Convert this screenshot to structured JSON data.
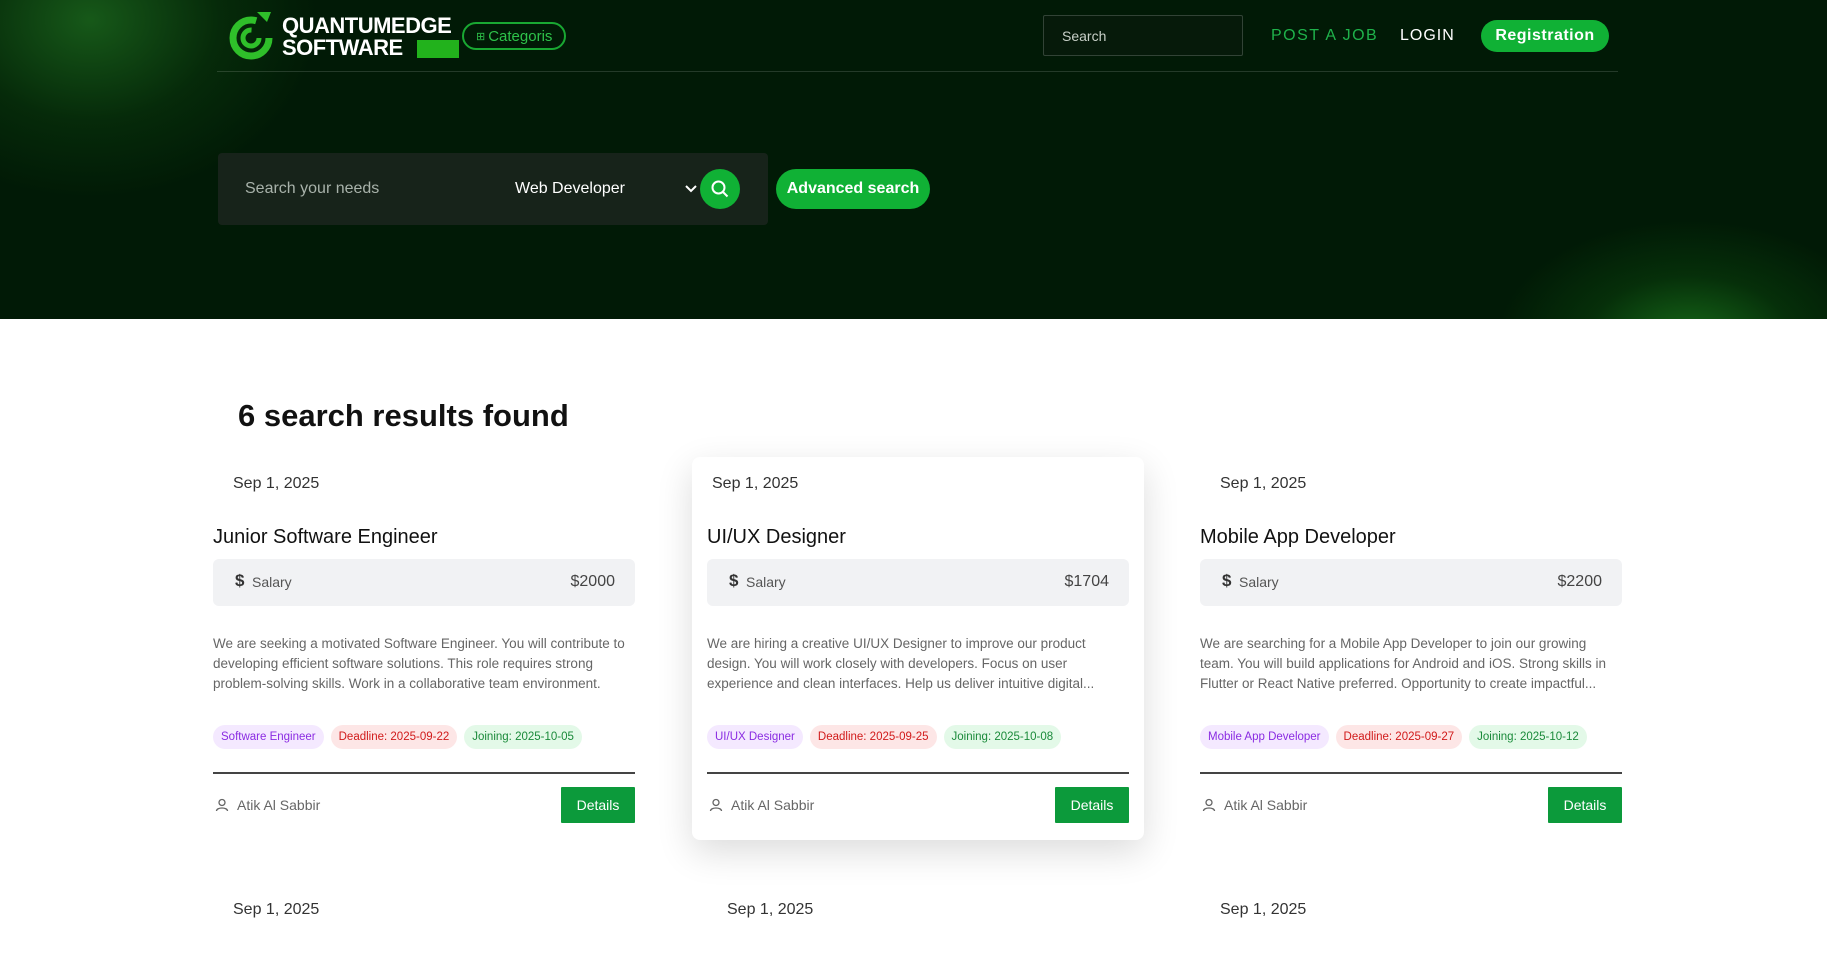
{
  "nav": {
    "logo_line1": "QUANTUMEDGE",
    "logo_line2": "SOFTWARE",
    "categories_label": "Categoris",
    "search_placeholder": "Search",
    "post_job": "POST A JOB",
    "login": "LOGIN",
    "registration": "Registration"
  },
  "hero": {
    "needs_placeholder": "Search your needs",
    "selected_role": "Web Developer",
    "advanced_search": "Advanced search"
  },
  "results": {
    "heading": "6 search results found",
    "jobs": [
      {
        "date": "Sep 1, 2025",
        "title": "Junior Software Engineer",
        "salary_label": "Salary",
        "salary": "$2000",
        "description": "We are seeking a motivated Software Engineer. You will contribute to developing efficient software solutions. This role requires strong problem-solving skills. Work in a collaborative team environment.",
        "role_tag": "Software Engineer",
        "deadline": "Deadline: 2025-09-22",
        "joining": "Joining: 2025-10-05",
        "author": "Atik Al Sabbir",
        "details": "Details"
      },
      {
        "date": "Sep 1, 2025",
        "title": "UI/UX Designer",
        "salary_label": "Salary",
        "salary": "$1704",
        "description": "We are hiring a creative UI/UX Designer to improve our product design. You will work closely with developers. Focus on user experience and clean interfaces. Help us deliver intuitive digital...",
        "role_tag": "UI/UX Designer",
        "deadline": "Deadline: 2025-09-25",
        "joining": "Joining: 2025-10-08",
        "author": "Atik Al Sabbir",
        "details": "Details"
      },
      {
        "date": "Sep 1, 2025",
        "title": "Mobile App Developer",
        "salary_label": "Salary",
        "salary": "$2200",
        "description": "We are searching for a Mobile App Developer to join our growing team. You will build applications for Android and iOS. Strong skills in Flutter or React Native preferred. Opportunity to create impactful...",
        "role_tag": "Mobile App Developer",
        "deadline": "Deadline: 2025-09-27",
        "joining": "Joining: 2025-10-12",
        "author": "Atik Al Sabbir",
        "details": "Details"
      }
    ],
    "next_row_dates": [
      "Sep 1, 2025",
      "Sep 1, 2025",
      "Sep 1, 2025"
    ]
  },
  "colors": {
    "hero_bg": "#011a06",
    "accent": "#10b135",
    "details_button": "#0c9a3b"
  },
  "icons": {
    "logo": "spiral-logo-icon",
    "categories": "grid-icon",
    "search_button": "search-icon",
    "dropdown": "chevron-down-icon",
    "salary": "dollar-icon",
    "author": "user-icon"
  }
}
